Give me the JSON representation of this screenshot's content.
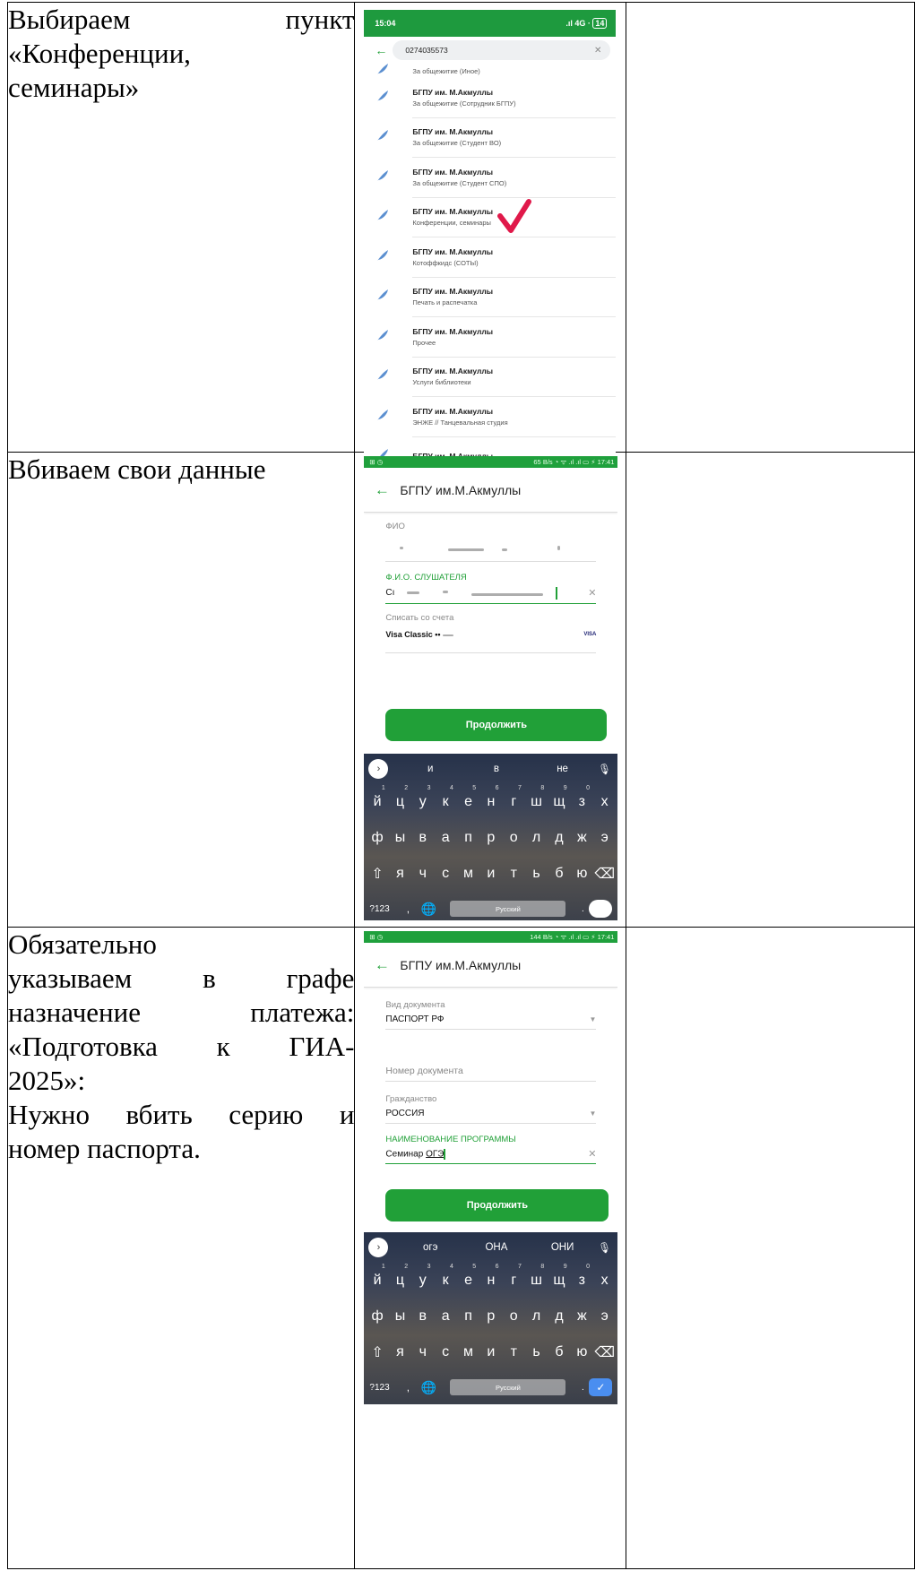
{
  "rows": [
    {
      "instruction": [
        "Выбираем пункт",
        "«Конференции,",
        "семинары»"
      ]
    },
    {
      "instruction": [
        "Вбиваем свои данные"
      ]
    },
    {
      "instruction": [
        "Обязательно",
        "указываем в графе",
        "назначение платежа:",
        "«Подготовка к ГИА-",
        "2025»:",
        "Нужно вбить серию и",
        "номер паспорта."
      ]
    }
  ],
  "screen1": {
    "time": "15:04",
    "signal": "4G",
    "battery": "14",
    "search_value": "0274035573",
    "partial_top_subtitle": "За общежитие (Иное)",
    "items": [
      {
        "title": "БГПУ им. М.Акмуллы",
        "subtitle": "За общежитие (Сотрудник БГПУ)"
      },
      {
        "title": "БГПУ им. М.Акмуллы",
        "subtitle": "За общежитие (Студент ВО)"
      },
      {
        "title": "БГПУ им. М.Акмуллы",
        "subtitle": "За общежитие (Студент СПО)"
      },
      {
        "title": "БГПУ им. М.Акмуллы",
        "subtitle": "Конференции, семинары"
      },
      {
        "title": "БГПУ им. М.Акмуллы",
        "subtitle": "Котоффкидс (СОТЫ)"
      },
      {
        "title": "БГПУ им. М.Акмуллы",
        "subtitle": "Печать и распечатка"
      },
      {
        "title": "БГПУ им. М.Акмуллы",
        "subtitle": "Прочее"
      },
      {
        "title": "БГПУ им. М.Акмуллы",
        "subtitle": "Услуги библиотеки"
      },
      {
        "title": "БГПУ им. М.Акмуллы",
        "subtitle": "ЭНЖЕ // Танцевальная студия"
      },
      {
        "title": "БГПУ им. М.Акмуллы",
        "subtitle": ""
      }
    ],
    "accent": "#21a038",
    "check_color": "#e0194a"
  },
  "screen2": {
    "status_left": "⊞ ◷",
    "status_right": "65 B/s ◔ ᯤ .ıl .ıl ▭ ⚡ 17:41",
    "title": "БГПУ им.М.Акмуллы",
    "fio_label": "ФИО",
    "listener_label": "Ф.И.О. СЛУШАТЕЛЯ",
    "listener_value_start": "Сı",
    "account_label": "Списать со счета",
    "card": "Visa Classic •• ",
    "card_brand": "VISA",
    "button": "Продолжить",
    "suggestions": [
      "и",
      "в",
      "не"
    ],
    "space_label": "Русский",
    "num_key": "?123"
  },
  "screen3": {
    "status_left": "⊞ ◷",
    "status_right": "144 B/s ◔ ᯤ .ıl .ıl ▭ ⚡ 17:41",
    "title": "БГПУ им.М.Акмуллы",
    "doc_type_label": "Вид документа",
    "doc_type_value": "ПАСПОРТ РФ",
    "doc_number_placeholder": "Номер документа",
    "citizenship_label": "Гражданство",
    "citizenship_value": "РОССИЯ",
    "program_label": "НАИМЕНОВАНИЕ ПРОГРАММЫ",
    "program_value_word": "Семинар",
    "program_value_underlined": "ОГЭ",
    "button": "Продолжить",
    "suggestions": [
      "огэ",
      "ОНА",
      "ОНИ"
    ],
    "space_label": "Русский",
    "num_key": "?123"
  },
  "keyboard_rows": [
    [
      "й",
      "ц",
      "у",
      "к",
      "е",
      "н",
      "г",
      "ш",
      "щ",
      "з",
      "х"
    ],
    [
      "ф",
      "ы",
      "в",
      "а",
      "п",
      "р",
      "о",
      "л",
      "д",
      "ж",
      "э"
    ],
    [
      "⇧",
      "я",
      "ч",
      "с",
      "м",
      "и",
      "т",
      "ь",
      "б",
      "ю",
      "⌫"
    ]
  ],
  "keyboard_digits": [
    "1",
    "2",
    "3",
    "4",
    "5",
    "6",
    "7",
    "8",
    "9",
    "0"
  ]
}
